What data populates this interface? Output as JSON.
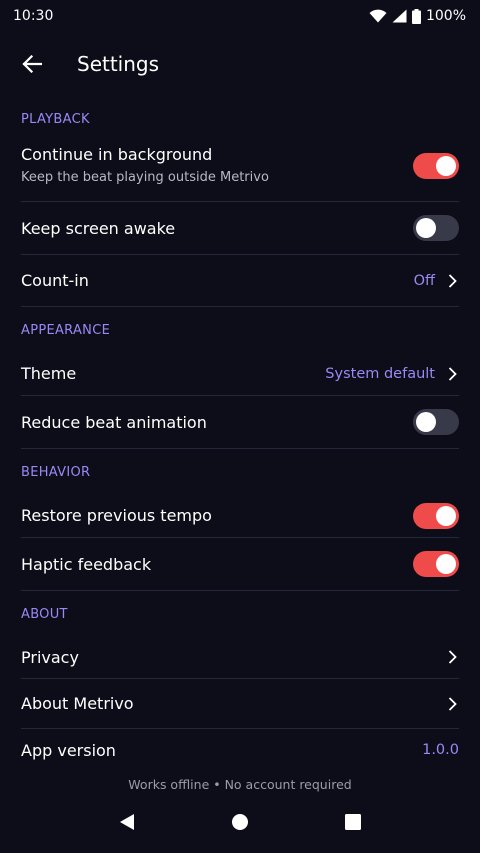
{
  "status": {
    "time": "10:30",
    "battery": "100%"
  },
  "header": {
    "title": "Settings"
  },
  "sections": {
    "playback": {
      "title": "PLAYBACK",
      "continue_bg": {
        "label": "Continue in background",
        "sub": "Keep the beat playing outside Metrivo",
        "on": true
      },
      "keep_awake": {
        "label": "Keep screen awake",
        "on": false
      },
      "count_in": {
        "label": "Count-in",
        "value": "Off"
      }
    },
    "appearance": {
      "title": "APPEARANCE",
      "theme": {
        "label": "Theme",
        "value": "System default"
      },
      "reduce_anim": {
        "label": "Reduce beat animation",
        "on": false
      }
    },
    "behavior": {
      "title": "BEHAVIOR",
      "restore_tempo": {
        "label": "Restore previous tempo",
        "on": true
      },
      "haptic": {
        "label": "Haptic feedback",
        "on": true
      }
    },
    "about": {
      "title": "ABOUT",
      "privacy": {
        "label": "Privacy"
      },
      "about_app": {
        "label": "About Metrivo"
      },
      "version": {
        "label": "App version",
        "value": "1.0.0"
      }
    }
  },
  "footer": {
    "text": "Works offline • No account required"
  },
  "colors": {
    "accent": "#9b87f5",
    "toggle_on": "#f04b4b",
    "toggle_off": "#383a4a",
    "background": "#0c0d18"
  },
  "icons": {
    "back": "arrow-left-icon",
    "chevron": "chevron-right-icon",
    "wifi": "wifi-icon",
    "signal": "signal-icon",
    "battery": "battery-icon",
    "nav_back": "nav-back-icon",
    "nav_home": "nav-home-icon",
    "nav_recents": "nav-recents-icon"
  }
}
